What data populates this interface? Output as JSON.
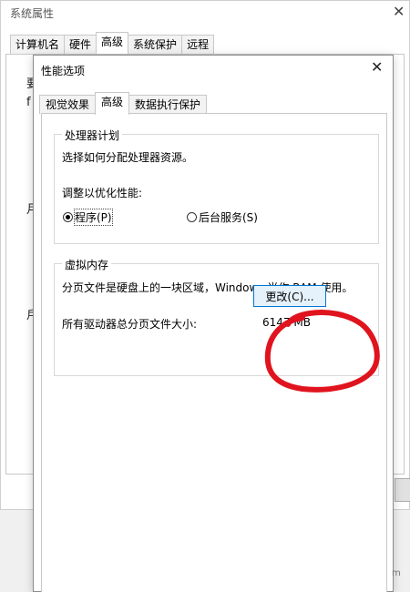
{
  "background_window": {
    "title": "系统属性",
    "close_glyph": "✕",
    "tabs": [
      {
        "label": "计算机名",
        "active": false
      },
      {
        "label": "硬件",
        "active": false
      },
      {
        "label": "高级",
        "active": true
      },
      {
        "label": "系统保护",
        "active": false
      },
      {
        "label": "远程",
        "active": false
      }
    ]
  },
  "dialog": {
    "title": "性能选项",
    "close_glyph": "✕",
    "tabs": [
      {
        "label": "视觉效果",
        "active": false
      },
      {
        "label": "高级",
        "active": true
      },
      {
        "label": "数据执行保护",
        "active": false
      }
    ],
    "processor": {
      "legend": "处理器计划",
      "description": "选择如何分配处理器资源。",
      "adjust_label": "调整以优化性能:",
      "options": [
        {
          "label": "程序(P)",
          "selected": true
        },
        {
          "label": "后台服务(S)",
          "selected": false
        }
      ]
    },
    "virtual_memory": {
      "legend": "虚拟内存",
      "description": "分页文件是硬盘上的一块区域，Windows 当作 RAM 使用。",
      "total_label": "所有驱动器总分页文件大小:",
      "total_value": "6147 MB",
      "change_button": "更改(C)..."
    }
  },
  "annotation": {
    "color": "#e0141e"
  }
}
